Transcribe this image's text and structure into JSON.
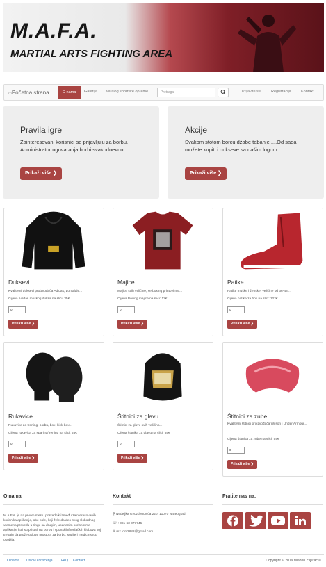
{
  "banner": {
    "title": "M.A.F.A.",
    "subtitle": "MARTIAL ARTS FIGHTING AREA"
  },
  "nav": {
    "home": "Početna strana",
    "items": [
      "O nama",
      "Galerija",
      "Katalog sportske opreme"
    ],
    "search_placeholder": "Pretraga",
    "right_items": [
      "Prijavite se",
      "Registracija",
      "Kontakt"
    ]
  },
  "jumbotrons": [
    {
      "title": "Pravila igre",
      "text": "Zainteresovani korisnici se prijavljuju za borbu. Administrator ugovaranja borbi svakodnevno ....",
      "button": "Prikaži više"
    },
    {
      "title": "Akcije",
      "text": "Svakom stotom borcu džabe tabanje ....Od sada možete kupiti i dukseve sa našim logom....",
      "button": "Prikaži više"
    }
  ],
  "products": [
    {
      "title": "Duksevi",
      "desc": "Kvalitetni duksevi proizvođača Adidas, Lonsdale...",
      "price": "Cijena Adidas muskog duksa na slici: 35€",
      "qty": "0",
      "button": "Prikaži više"
    },
    {
      "title": "Majice",
      "desc": "Majice svih veličine, se boxing printovima ...",
      "price": "Cijena Boxing majice na slici: 12€",
      "qty": "0",
      "button": "Prikaži više"
    },
    {
      "title": "Patike",
      "desc": "Patike muške i ženske, veličine od 36-48...",
      "price": "Cijena patike za box na slici: 122€",
      "qty": "0",
      "button": "Prikaži više"
    },
    {
      "title": "Rukavice",
      "desc": "Rukavice za trening, borbu, box, kick-box...",
      "price": "Cijena rukavica za sparing/trening na slici: 55€",
      "qty": "0",
      "button": "Prikaži više"
    },
    {
      "title": "Štitnici za glavu",
      "desc": "Štitnici za glavu svih veličina...",
      "price": "Cijena štitnika za glavu na slici: 85€",
      "qty": "0",
      "button": "Prikaži više"
    },
    {
      "title": "Štitnici za zube",
      "desc": "Kvalitetni štitnici proizvođača Wilson i Under Armour...",
      "price": "Cijena štitnika za zube na slici: 55€",
      "qty": "0",
      "button": "Prikaži više"
    }
  ],
  "footer": {
    "about_title": "O nama",
    "about_text": "M.A.F.A. je na prvom mestu posrednik između zainteresovanih korisnika aplikacije, obe pole, koji žele da deo svog slobodnog vremena provedu u ringu sa drugim, upanenim korisnicima aplikacije koji su pristali na borbu i sportskih/borilačkih klubova koji trebaju da pruže usluge prostora za borbu, sudije i medicinskog osoblja.",
    "contact_title": "Kontakt",
    "address": "Nedeljka Gvozdenovića 22b, 11070 N.Beograd",
    "phone": "+381 63 377745",
    "email": "mz.loof2882@gmail.com",
    "follow_title": "Pratite nas na:",
    "social": [
      "facebook",
      "twitter",
      "youtube",
      "linkedin"
    ],
    "bottom_links": [
      "O nama",
      "Uslovi korišćenja",
      "FAQ",
      "Kontakt"
    ],
    "copyright": "Copyright © 2019 Mladen Zvjerac ©"
  },
  "colors": {
    "accent": "#a94442",
    "link": "#337ab7"
  }
}
